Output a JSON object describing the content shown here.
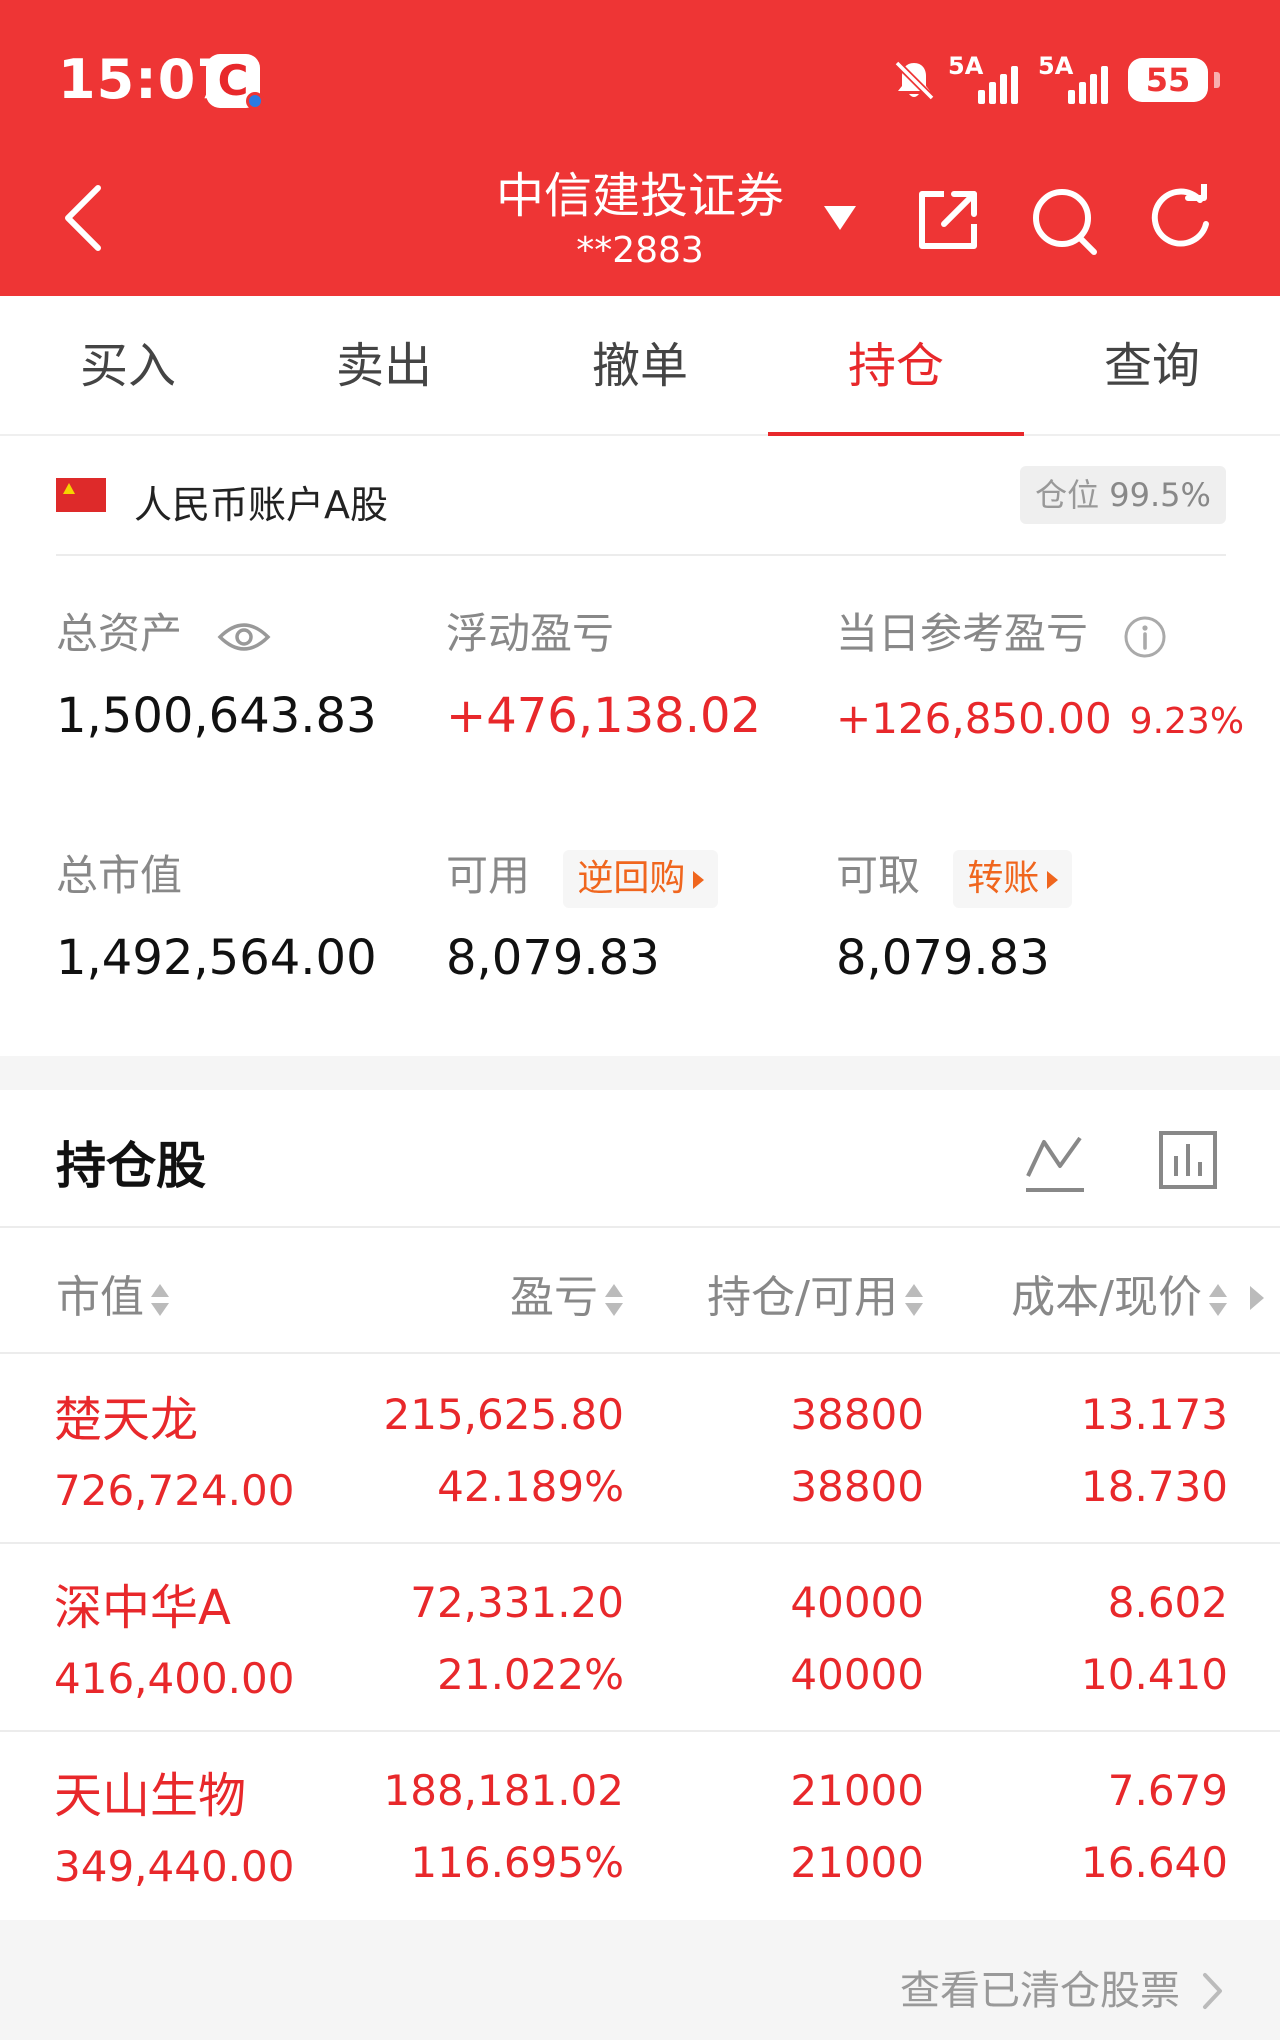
{
  "status_bar": {
    "time": "15:07",
    "app_badge": "C",
    "signal_1": "5A",
    "signal_2": "5A",
    "battery": "55"
  },
  "header": {
    "title": "中信建投证券",
    "account": "**2883"
  },
  "tabs": [
    {
      "label": "买入"
    },
    {
      "label": "卖出"
    },
    {
      "label": "撤单"
    },
    {
      "label": "持仓"
    },
    {
      "label": "查询"
    }
  ],
  "account_bar": {
    "label": "人民币账户A股",
    "position_label": "仓位",
    "position_value": "99.5%"
  },
  "summary": {
    "total_assets_label": "总资产",
    "total_assets": "1,500,643.83",
    "floating_pl_label": "浮动盈亏",
    "floating_pl": "+476,138.02",
    "daily_pl_label": "当日参考盈亏",
    "daily_pl": "+126,850.00",
    "daily_pl_pct": "9.23%",
    "market_value_label": "总市值",
    "market_value": "1,492,564.00",
    "available_label": "可用",
    "available_action": "逆回购",
    "available": "8,079.83",
    "withdrawable_label": "可取",
    "withdrawable_action": "转账",
    "withdrawable": "8,079.83"
  },
  "holdings": {
    "title": "持仓股",
    "columns": {
      "market_value": "市值",
      "pl": "盈亏",
      "hold_avail": "持仓/可用",
      "cost_price": "成本/现价"
    },
    "rows": [
      {
        "name": "楚天龙",
        "market_value": "726,724.00",
        "pl": "215,625.80",
        "pl_pct": "42.189%",
        "hold": "38800",
        "avail": "38800",
        "cost": "13.173",
        "price": "18.730"
      },
      {
        "name": "深中华A",
        "market_value": "416,400.00",
        "pl": "72,331.20",
        "pl_pct": "21.022%",
        "hold": "40000",
        "avail": "40000",
        "cost": "8.602",
        "price": "10.410"
      },
      {
        "name": "天山生物",
        "market_value": "349,440.00",
        "pl": "188,181.02",
        "pl_pct": "116.695%",
        "hold": "21000",
        "avail": "21000",
        "cost": "7.679",
        "price": "16.640"
      }
    ]
  },
  "footer": {
    "link": "查看已清仓股票"
  },
  "colors": {
    "brand_red": "#ee3535",
    "gain_red": "#e8282b",
    "action_orange": "#f0661e"
  }
}
